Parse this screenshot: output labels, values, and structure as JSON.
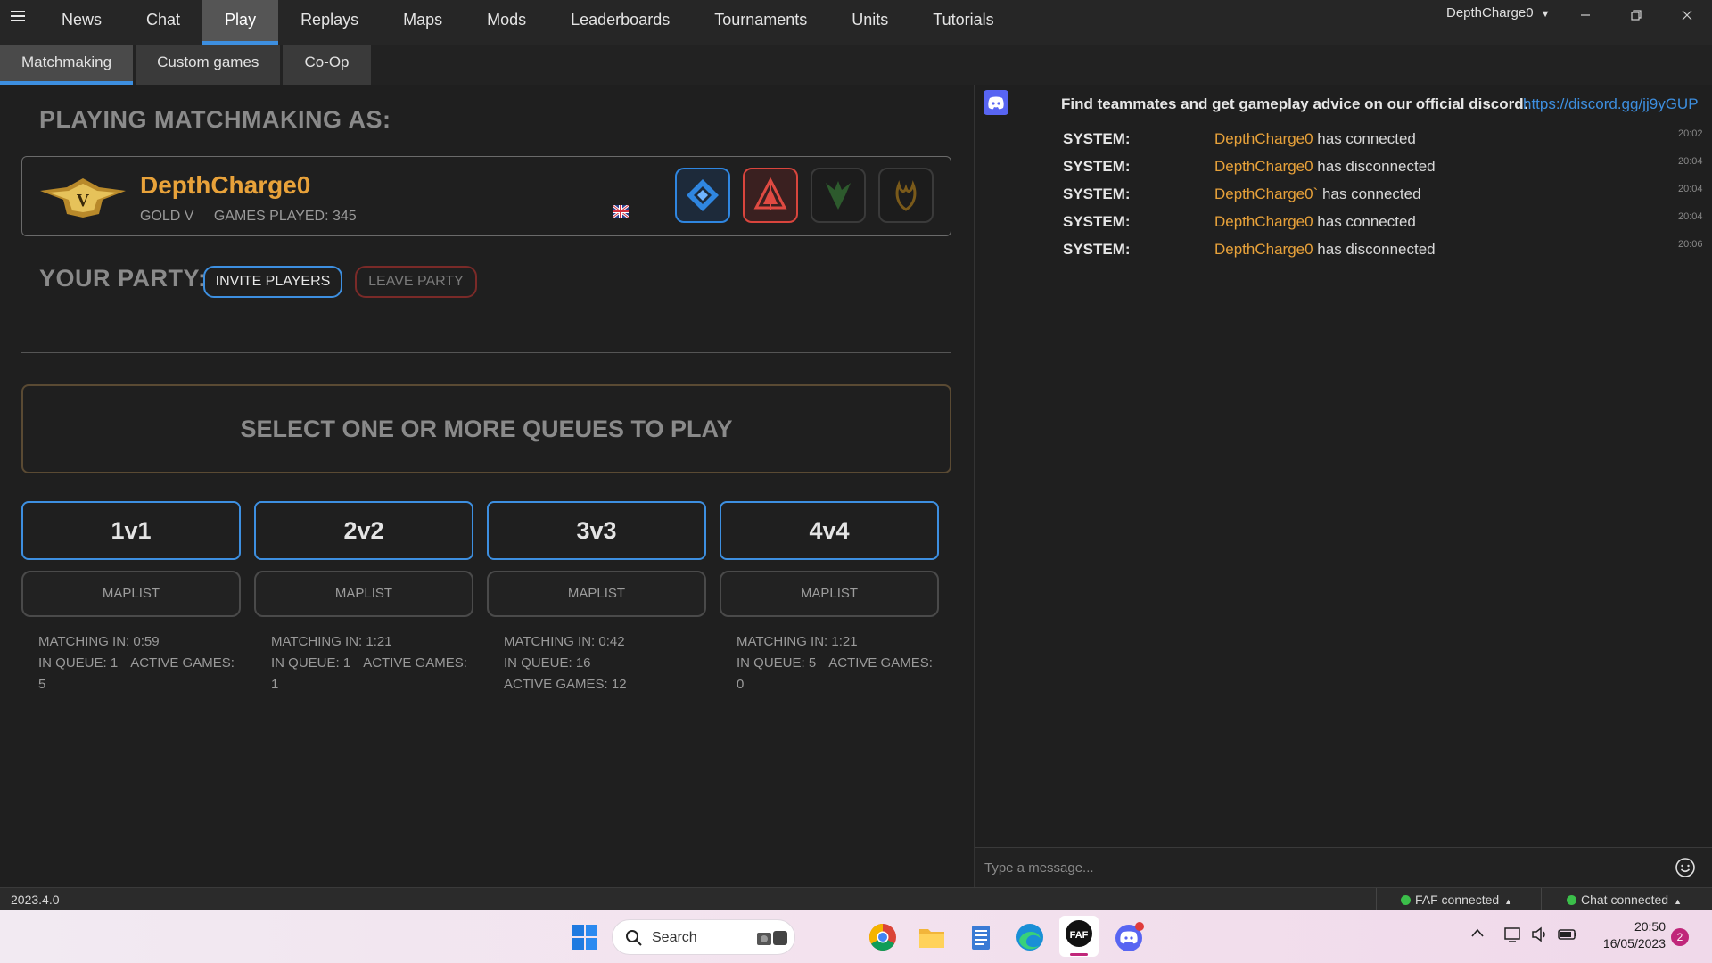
{
  "nav": {
    "items": [
      "News",
      "Chat",
      "Play",
      "Replays",
      "Maps",
      "Mods",
      "Leaderboards",
      "Tournaments",
      "Units",
      "Tutorials"
    ],
    "active": "Play"
  },
  "window": {
    "user": "DepthCharge0"
  },
  "subtabs": {
    "items": [
      "Matchmaking",
      "Custom games",
      "Co-Op"
    ],
    "active": "Matchmaking"
  },
  "player": {
    "heading": "PLAYING MATCHMAKING AS:",
    "name": "DepthCharge0",
    "rank": "GOLD V",
    "rank_badge_letter": "V",
    "games_played": "GAMES PLAYED: 345"
  },
  "party": {
    "heading": "YOUR PARTY:",
    "invite_label": "INVITE PLAYERS",
    "leave_label": "LEAVE PARTY"
  },
  "queue_banner": "SELECT ONE OR MORE QUEUES TO PLAY",
  "queues": [
    {
      "name": "1v1",
      "maplist": "MAPLIST",
      "matching": "MATCHING IN: 0:59",
      "in_queue": "IN QUEUE: 1",
      "active_games": "ACTIVE GAMES: 5"
    },
    {
      "name": "2v2",
      "maplist": "MAPLIST",
      "matching": "MATCHING IN: 1:21",
      "in_queue": "IN QUEUE: 1",
      "active_games": "ACTIVE GAMES: 1"
    },
    {
      "name": "3v3",
      "maplist": "MAPLIST",
      "matching": "MATCHING IN: 0:42",
      "in_queue": "IN QUEUE: 16",
      "active_games": "ACTIVE GAMES: 12"
    },
    {
      "name": "4v4",
      "maplist": "MAPLIST",
      "matching": "MATCHING IN: 1:21",
      "in_queue": "IN QUEUE: 5",
      "active_games": "ACTIVE GAMES: 0"
    }
  ],
  "chat": {
    "discord_text": "Find teammates and get gameplay advice on our official discord:",
    "discord_link": "https://discord.gg/jj9yGUP",
    "messages": [
      {
        "sender": "SYSTEM:",
        "user": "DepthCharge0",
        "text": " has connected",
        "time": "20:02"
      },
      {
        "sender": "SYSTEM:",
        "user": "DepthCharge0",
        "text": " has disconnected",
        "time": "20:04"
      },
      {
        "sender": "SYSTEM:",
        "user": "DepthCharge0`",
        "text": " has connected",
        "time": "20:04"
      },
      {
        "sender": "SYSTEM:",
        "user": "DepthCharge0",
        "text": " has connected",
        "time": "20:04"
      },
      {
        "sender": "SYSTEM:",
        "user": "DepthCharge0",
        "text": " has disconnected",
        "time": "20:06"
      }
    ],
    "input_placeholder": "Type a message..."
  },
  "status": {
    "version": "2023.4.0",
    "faf": "FAF connected",
    "chat": "Chat connected"
  },
  "taskbar": {
    "search_label": "Search",
    "time": "20:50",
    "date": "16/05/2023",
    "notifications": "2",
    "faf_icon_text": "FAF"
  },
  "colors": {
    "accent": "#3d8fe0",
    "username": "#e8a23a",
    "danger": "#d9453d",
    "online": "#3bbf4a"
  }
}
